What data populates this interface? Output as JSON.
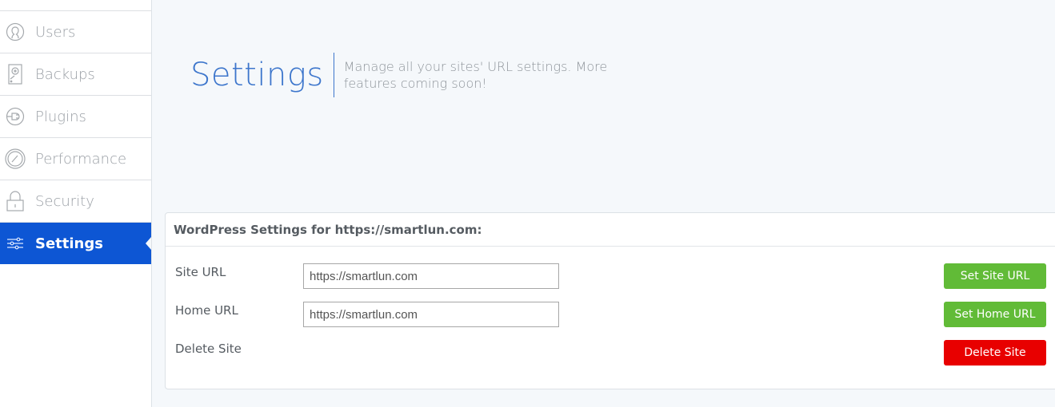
{
  "sidebar": {
    "items": [
      {
        "label": "Users",
        "icon": "user-icon"
      },
      {
        "label": "Backups",
        "icon": "hard-drive-icon"
      },
      {
        "label": "Plugins",
        "icon": "plug-icon"
      },
      {
        "label": "Performance",
        "icon": "gauge-icon"
      },
      {
        "label": "Security",
        "icon": "lock-icon"
      },
      {
        "label": "Settings",
        "icon": "sliders-icon",
        "active": true
      }
    ]
  },
  "header": {
    "title": "Settings",
    "subtitle": "Manage all your sites' URL settings. More features coming soon!"
  },
  "panel": {
    "title": "WordPress Settings for https://smartlun.com:",
    "rows": [
      {
        "label": "Site URL",
        "value": "https://smartlun.com",
        "button": "Set Site URL"
      },
      {
        "label": "Home URL",
        "value": "https://smartlun.com",
        "button": "Set Home URL"
      },
      {
        "label": "Delete Site",
        "button": "Delete Site"
      }
    ]
  },
  "colors": {
    "accent": "#0d56d4",
    "title": "#3d76cc",
    "green": "#61bb37",
    "red": "#e80000"
  }
}
